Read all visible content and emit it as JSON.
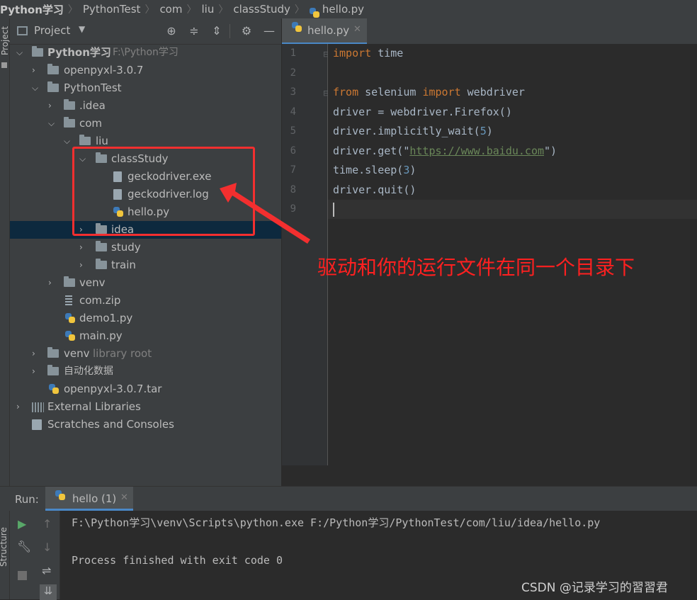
{
  "breadcrumb": [
    "Python学习",
    "PythonTest",
    "com",
    "liu",
    "classStudy",
    "hello.py"
  ],
  "left_stripe": {
    "label": "Project"
  },
  "project_panel": {
    "title": "Project"
  },
  "tree": [
    {
      "label": "Python学习",
      "hint": "F:\\Python学习",
      "icon": "folder-icon",
      "expanded": true
    },
    {
      "label": "openpyxl-3.0.7",
      "icon": "folder-icon",
      "expanded": false
    },
    {
      "label": "PythonTest",
      "icon": "folder-icon",
      "expanded": true
    },
    {
      "label": ".idea",
      "icon": "folder-icon",
      "expanded": false
    },
    {
      "label": "com",
      "icon": "folder-icon",
      "expanded": true
    },
    {
      "label": "liu",
      "icon": "folder-icon",
      "expanded": true
    },
    {
      "label": "classStudy",
      "icon": "folder-icon",
      "expanded": true
    },
    {
      "label": "geckodriver.exe",
      "icon": "unknown-file-icon"
    },
    {
      "label": "geckodriver.log",
      "icon": "text-file-icon"
    },
    {
      "label": "hello.py",
      "icon": "python-file-icon"
    },
    {
      "label": "idea",
      "icon": "folder-icon",
      "expanded": false,
      "selected": true
    },
    {
      "label": "study",
      "icon": "folder-icon",
      "expanded": false
    },
    {
      "label": "train",
      "icon": "folder-icon",
      "expanded": false
    },
    {
      "label": "venv",
      "icon": "folder-icon",
      "expanded": false
    },
    {
      "label": "com.zip",
      "icon": "zip-file-icon"
    },
    {
      "label": "demo1.py",
      "icon": "python-file-icon"
    },
    {
      "label": "main.py",
      "icon": "python-file-icon"
    },
    {
      "label": "venv",
      "hint": "library root",
      "icon": "folder-icon",
      "expanded": false
    },
    {
      "label": "自动化数据",
      "icon": "folder-icon",
      "expanded": false
    },
    {
      "label": "openpyxl-3.0.7.tar",
      "icon": "python-file-icon"
    },
    {
      "label": "External Libraries",
      "icon": "libraries-icon",
      "expanded": false
    },
    {
      "label": "Scratches and Consoles",
      "icon": "scratches-icon"
    }
  ],
  "editor": {
    "tab_label": "hello.py",
    "line_numbers": [
      "1",
      "2",
      "3",
      "4",
      "5",
      "6",
      "7",
      "8",
      "9"
    ],
    "code": {
      "l1_kw": "import",
      "l1_rest": " time",
      "l3_kw1": "from",
      "l3_mid": " selenium ",
      "l3_kw2": "import",
      "l3_rest": " webdriver",
      "l4": "driver = webdriver.Firefox()",
      "l5_a": "driver.implicitly_wait(",
      "l5_num": "5",
      "l5_b": ")",
      "l6_a": "driver.get(\"",
      "l6_url": "https://www.baidu.com",
      "l6_b": "\")",
      "l7_a": "time.sleep(",
      "l7_num": "3",
      "l7_b": ")",
      "l8": "driver.quit()"
    }
  },
  "run": {
    "label": "Run:",
    "tab_label": "hello (1)",
    "console_line1": "F:\\Python学习\\venv\\Scripts\\python.exe F:/Python学习/PythonTest/com/liu/idea/hello.py",
    "console_line2": "Process finished with exit code 0",
    "side_label": "Structure"
  },
  "annotation": "驱动和你的运行文件在同一个目录下",
  "watermark": "CSDN @记录学习的習習君",
  "colors": {
    "annotation": "#ff2020",
    "keyword": "#cc7832",
    "number": "#6897bb",
    "string": "#6a8759",
    "selection": "#0d293e"
  }
}
